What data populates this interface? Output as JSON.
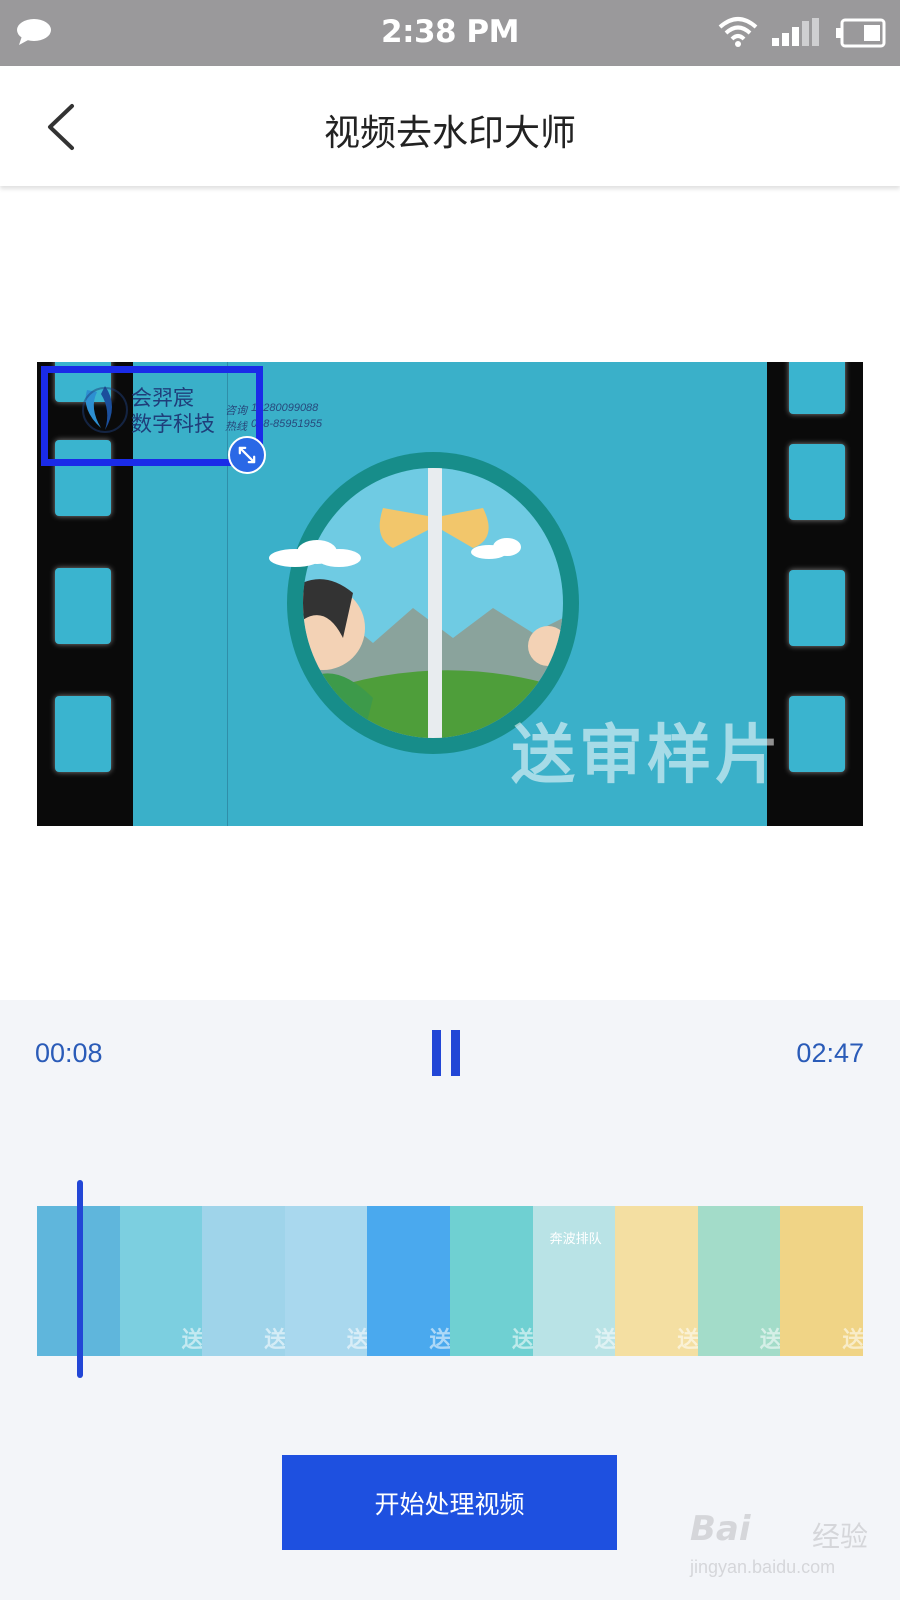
{
  "status_bar": {
    "time": "2:38 PM",
    "icons": [
      "message-icon",
      "wifi-icon",
      "signal-icon",
      "battery-icon"
    ]
  },
  "nav": {
    "title": "视频去水印大师",
    "back_icon": "chevron-left-icon"
  },
  "video": {
    "logo_name_line1": "会羿宸",
    "logo_name_line2": "数字科技",
    "logo_contact_label1": "咨询",
    "logo_contact_value1": "18280099088",
    "logo_contact_label2": "热线",
    "logo_contact_value2": "028-85951955",
    "watermark_text": "送审样片",
    "resize_icon": "resize-arrows-icon"
  },
  "player": {
    "current_time": "00:08",
    "total_time": "02:47",
    "pause_icon": "pause-icon",
    "progress_fraction": 0.048
  },
  "timeline": {
    "thumbnails": [
      {
        "bg": "#5fb6dc",
        "label": "",
        "wm": ""
      },
      {
        "bg": "#7ccfe0",
        "label": "",
        "wm": "送"
      },
      {
        "bg": "#9fd4ea",
        "label": "",
        "wm": "送"
      },
      {
        "bg": "#a9d8ee",
        "label": "",
        "wm": "送"
      },
      {
        "bg": "#4aa9ee",
        "label": "",
        "wm": "送"
      },
      {
        "bg": "#6fd0d2",
        "label": "",
        "wm": "送"
      },
      {
        "bg": "#b9e3e6",
        "label": "奔波排队",
        "wm": "送"
      },
      {
        "bg": "#f4dfa2",
        "label": "",
        "wm": "送"
      },
      {
        "bg": "#a3dcc9",
        "label": "",
        "wm": "送"
      },
      {
        "bg": "#f0d486",
        "label": "",
        "wm": "送"
      }
    ]
  },
  "actions": {
    "start_label": "开始处理视频"
  },
  "colors": {
    "accent": "#1e50e0",
    "time_text": "#2a5bb8",
    "selection_box": "#1a2be8"
  },
  "site_watermark": {
    "brand": "Bai",
    "brand2": "经验",
    "url": "jingyan.baidu.com"
  }
}
